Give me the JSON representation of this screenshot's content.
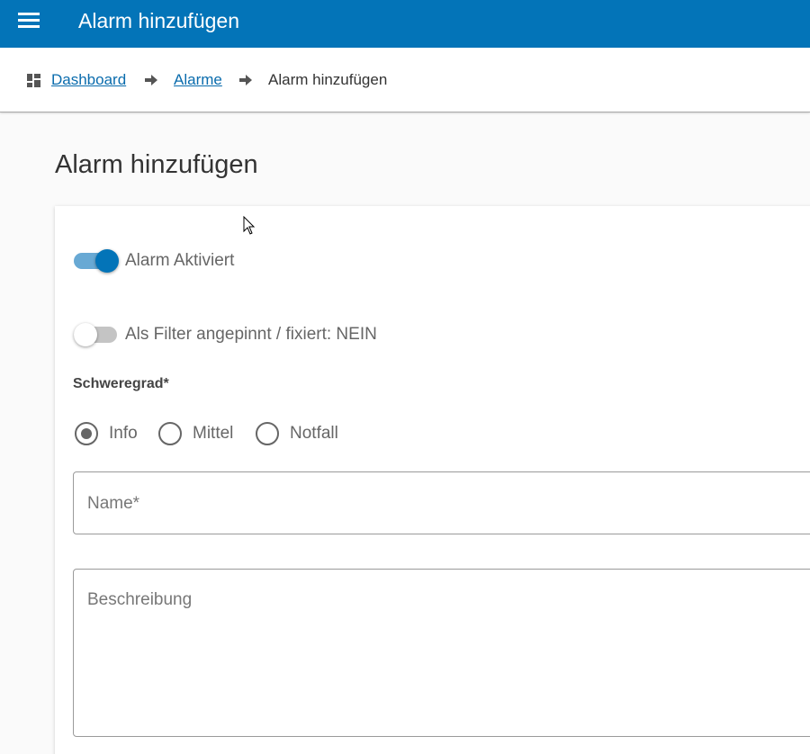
{
  "appbar": {
    "title": "Alarm hinzufügen",
    "menu_icon": "hamburger-menu-icon",
    "color": "#0374b8"
  },
  "breadcrumb": {
    "items": [
      {
        "label": "Dashboard",
        "icon": "dashboard-icon"
      },
      {
        "label": "Alarme"
      },
      {
        "label": "Alarm hinzufügen"
      }
    ],
    "separator_icon": "arrow-right-icon"
  },
  "page": {
    "title": "Alarm hinzufügen"
  },
  "form": {
    "toggle_active": {
      "label": "Alarm Aktiviert",
      "checked": true
    },
    "toggle_pinned": {
      "label": "Als Filter angepinnt / fixiert: NEIN",
      "checked": false
    },
    "severity": {
      "label": "Schweregrad*",
      "options": [
        {
          "label": "Info",
          "selected": true
        },
        {
          "label": "Mittel",
          "selected": false
        },
        {
          "label": "Notfall",
          "selected": false
        }
      ]
    },
    "name_field": {
      "placeholder": "Name*",
      "value": ""
    },
    "description_field": {
      "placeholder": "Beschreibung",
      "value": ""
    }
  }
}
